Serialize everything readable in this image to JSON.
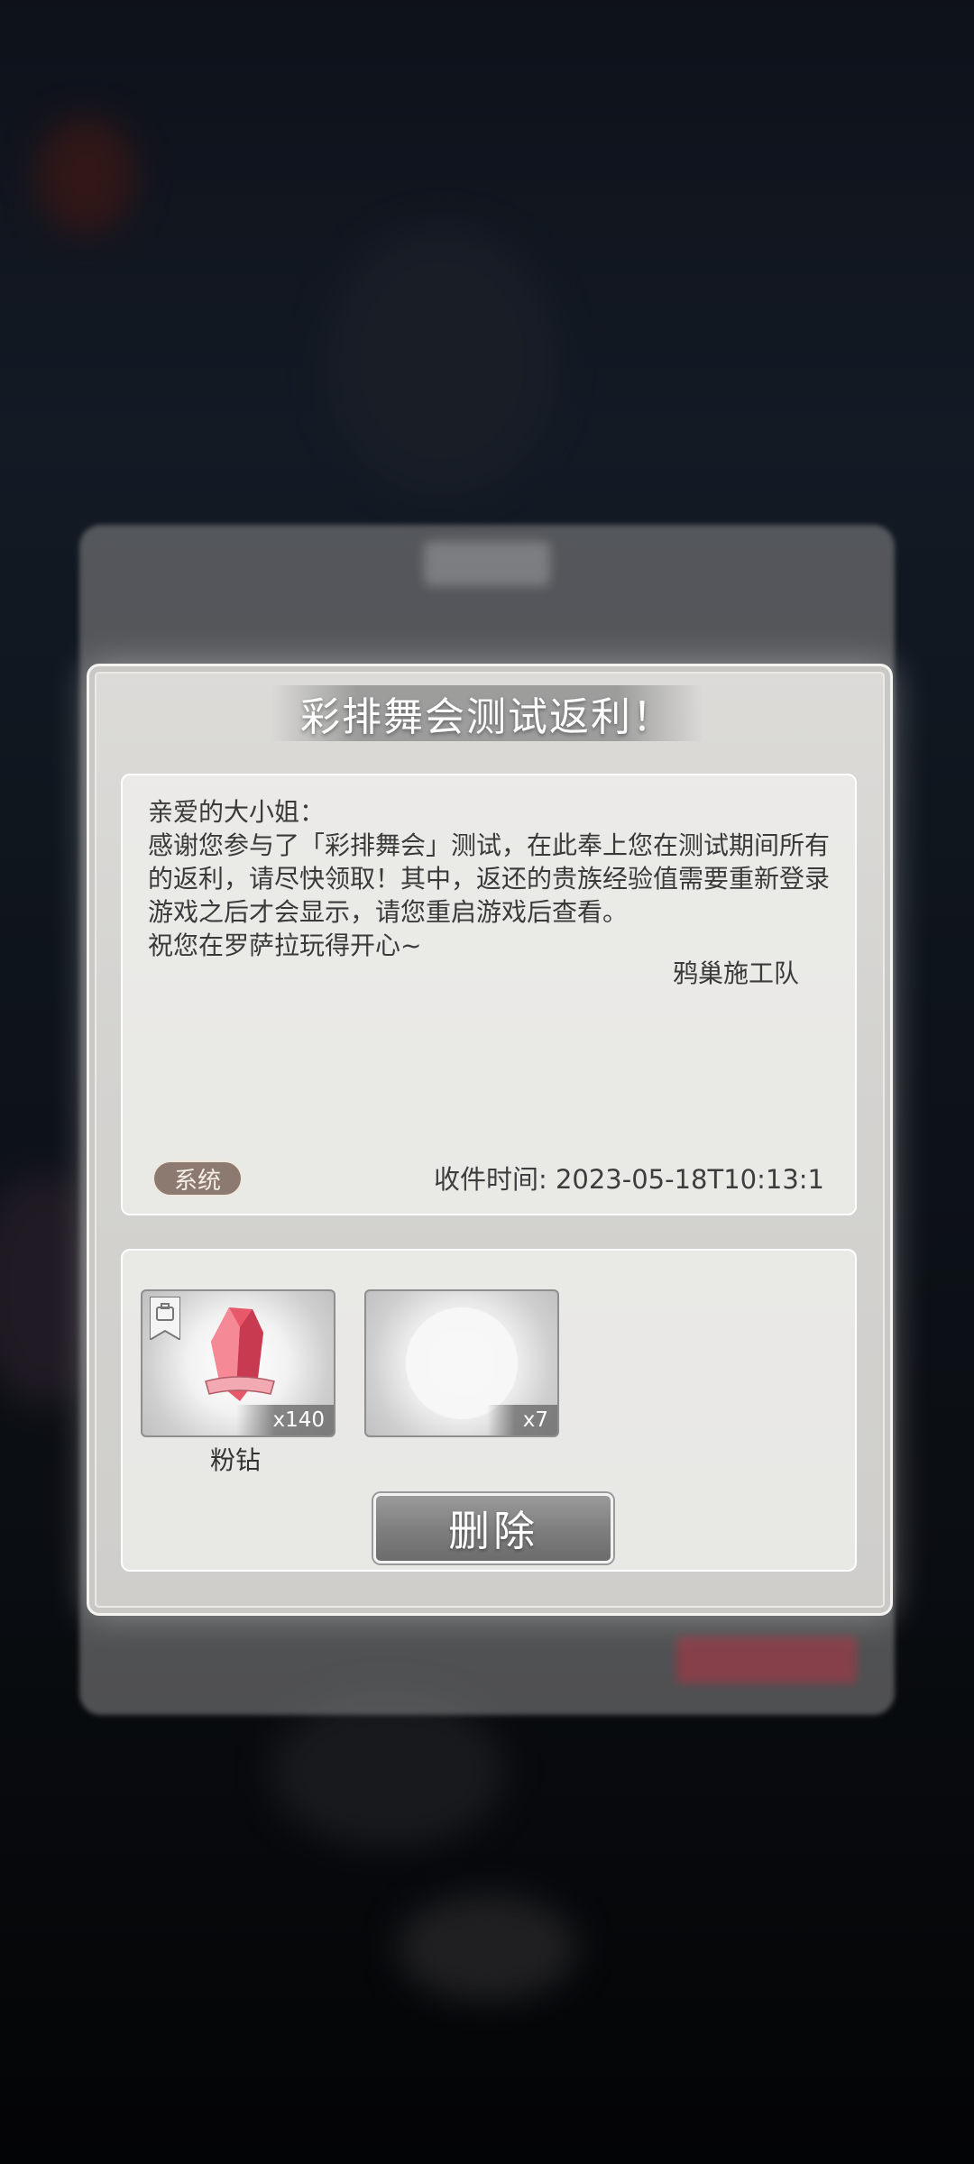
{
  "dialog": {
    "title": "彩排舞会测试返利！",
    "mail": {
      "greeting": "亲爱的大小姐：",
      "body": "感谢您参与了「彩排舞会」测试，在此奉上您在测试期间所有的返利，请尽快领取！其中，返还的贵族经验值需要重新登录游戏之后才会显示，请您重启游戏后查看。",
      "closing": "祝您在罗萨拉玩得开心~",
      "signature": "鸦巢施工队",
      "tag": "系统",
      "received_time": "收件时间: 2023-05-18T10:13:1"
    },
    "attachments": [
      {
        "name": "粉钻",
        "count": "x140",
        "icon": "pink-diamond-icon"
      },
      {
        "name": "",
        "count": "x7",
        "icon": "blank-item-icon"
      }
    ],
    "delete_label": "删除"
  },
  "colors": {
    "dialog_bg": "#d4d3d0",
    "tag_bg": "#8c7a70",
    "button_bg": "#7d7d7d",
    "gem": "#e7586a"
  }
}
